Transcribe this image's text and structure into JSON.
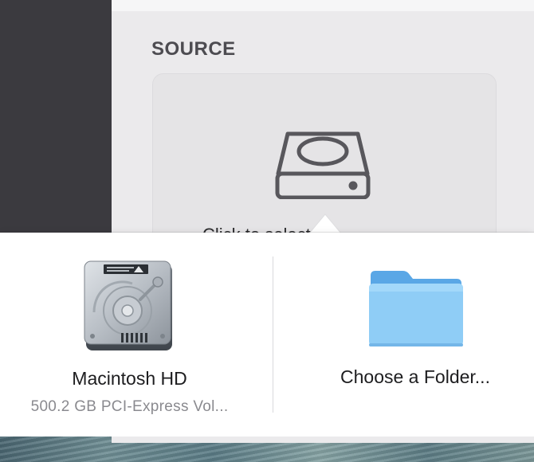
{
  "source_section": {
    "heading": "SOURCE",
    "card_text": "Click to select"
  },
  "source_picker": {
    "options": [
      {
        "name": "Macintosh HD",
        "detail": "500.2 GB PCI-Express Vol...",
        "icon": "hard-drive-icon"
      },
      {
        "name": "Choose a Folder...",
        "icon": "folder-icon"
      }
    ]
  },
  "colors": {
    "sidebar": "#3b3a3f",
    "panel": "#ebeaec",
    "folder_blue": "#7ec4f3"
  }
}
